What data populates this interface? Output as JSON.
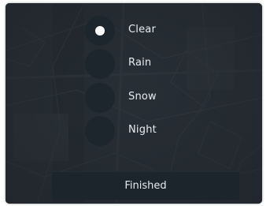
{
  "weather_options": [
    {
      "label": "Clear",
      "selected": true
    },
    {
      "label": "Rain",
      "selected": false
    },
    {
      "label": "Snow",
      "selected": false
    },
    {
      "label": "Night",
      "selected": false
    }
  ],
  "finish_button": {
    "label": "Finished"
  },
  "colors": {
    "panel": "#2a3138",
    "radio": "#1d252d",
    "button": "#1c242c",
    "text": "#e8ecef",
    "selected_dot": "#ffffff"
  }
}
